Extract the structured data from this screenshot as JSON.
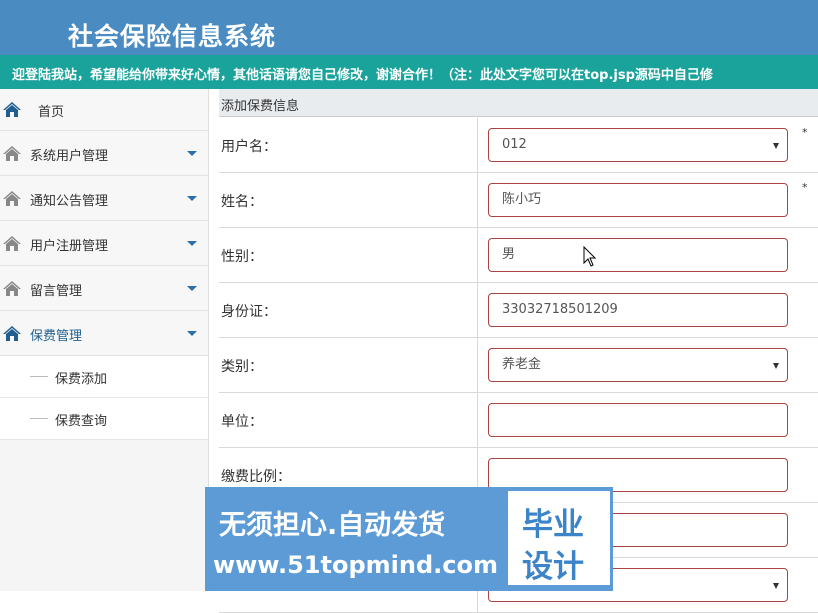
{
  "header": {
    "title": "社会保险信息系统",
    "marquee": "迎登陆我站，希望能给你带来好心情，其他话语请您自己修改，谢谢合作！（注：此处文字您可以在top.jsp源码中自己修"
  },
  "sidebar": {
    "home": "首页",
    "items": [
      {
        "label": "系统用户管理"
      },
      {
        "label": "通知公告管理"
      },
      {
        "label": "用户注册管理"
      },
      {
        "label": "留言管理"
      },
      {
        "label": "保费管理"
      }
    ],
    "subitems": [
      {
        "label": "保费添加"
      },
      {
        "label": "保费查询"
      }
    ]
  },
  "form": {
    "title": "添加保费信息",
    "required_mark": "*",
    "fields": [
      {
        "label": "用户名：",
        "value": "012",
        "type": "select"
      },
      {
        "label": "姓名：",
        "value": "陈小巧",
        "type": "input"
      },
      {
        "label": "性别：",
        "value": "男",
        "type": "input"
      },
      {
        "label": "身份证：",
        "value": "33032718501209",
        "type": "input"
      },
      {
        "label": "类别：",
        "value": "养老金",
        "type": "select"
      },
      {
        "label": "单位：",
        "value": "",
        "type": "input"
      },
      {
        "label": "缴费比例：",
        "value": "",
        "type": "input"
      }
    ]
  },
  "watermark": {
    "line1": "无须担心.自动发货",
    "line2": "www.51topmind.com",
    "badge1": "毕业",
    "badge2": "设计"
  },
  "colors": {
    "header": "#4a8bc2",
    "marquee": "#1aa39a",
    "field_border": "#a94442",
    "watermark": "#5d9bd6"
  }
}
